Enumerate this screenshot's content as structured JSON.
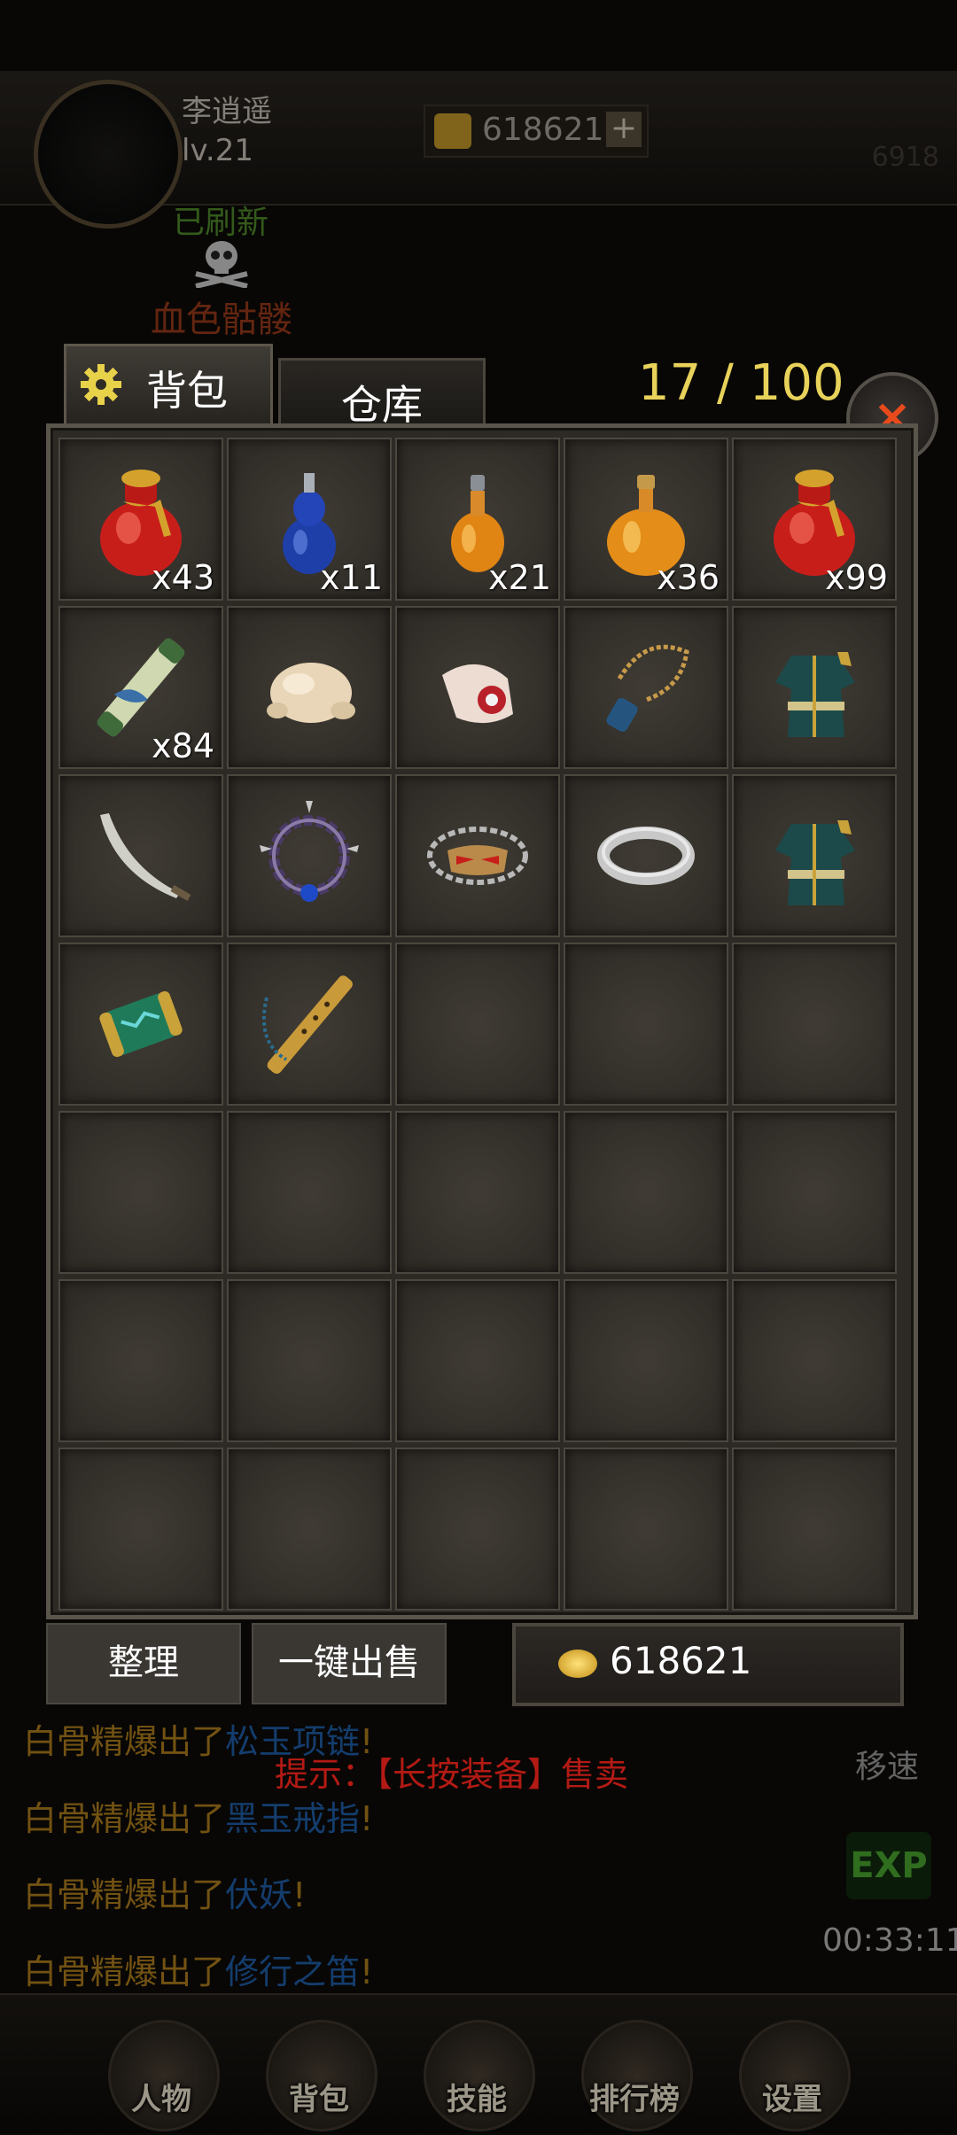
{
  "header": {
    "player_name": "李逍遥",
    "player_level": "lv.21",
    "gold": "618621",
    "plus_label": "+",
    "right_number": "6918"
  },
  "boss": {
    "status": "已刷新",
    "name": "血色骷髅"
  },
  "bag": {
    "tab_backpack": "背包",
    "tab_warehouse": "仓库",
    "capacity": "17 / 100",
    "close_label": "×",
    "rows": 7,
    "columns": 5,
    "items": [
      {
        "icon": "red-gourd-potion-icon",
        "qty": "x43"
      },
      {
        "icon": "blue-gourd-potion-icon",
        "qty": "x11"
      },
      {
        "icon": "orange-small-potion-icon",
        "qty": "x21"
      },
      {
        "icon": "orange-large-potion-icon",
        "qty": "x36"
      },
      {
        "icon": "red-gourd-potion-icon",
        "qty": "x99"
      },
      {
        "icon": "scroll-icon",
        "qty": "x84"
      },
      {
        "icon": "roast-chicken-icon",
        "qty": ""
      },
      {
        "icon": "meat-icon",
        "qty": ""
      },
      {
        "icon": "necklace-icon",
        "qty": ""
      },
      {
        "icon": "green-armor-icon",
        "qty": ""
      },
      {
        "icon": "sabre-icon",
        "qty": ""
      },
      {
        "icon": "spiked-bracelet-icon",
        "qty": ""
      },
      {
        "icon": "mask-belt-icon",
        "qty": ""
      },
      {
        "icon": "silver-ring-icon",
        "qty": ""
      },
      {
        "icon": "green-armor-icon",
        "qty": ""
      },
      {
        "icon": "bracer-icon",
        "qty": ""
      },
      {
        "icon": "flute-icon",
        "qty": ""
      }
    ],
    "sort_label": "整理",
    "sell_all_label": "一键出售",
    "gold": "618621",
    "hint": "提示：【长按装备】售卖"
  },
  "chat": [
    {
      "who": "白骨精",
      "verb": "爆出了",
      "item": "松玉项链",
      "end": "!"
    },
    {
      "who": "白骨精",
      "verb": "爆出了",
      "item": "黑玉戒指",
      "end": "!"
    },
    {
      "who": "白骨精",
      "verb": "爆出了",
      "item": "伏妖",
      "end": "!"
    },
    {
      "who": "白骨精",
      "verb": "爆出了",
      "item": "修行之笛",
      "end": "!"
    }
  ],
  "side": {
    "move_speed": "移速",
    "exp": "EXP",
    "timer": "00:33:11"
  },
  "nav": [
    {
      "label": "人物"
    },
    {
      "label": "背包"
    },
    {
      "label": "技能"
    },
    {
      "label": "排行榜"
    },
    {
      "label": "设置"
    }
  ]
}
